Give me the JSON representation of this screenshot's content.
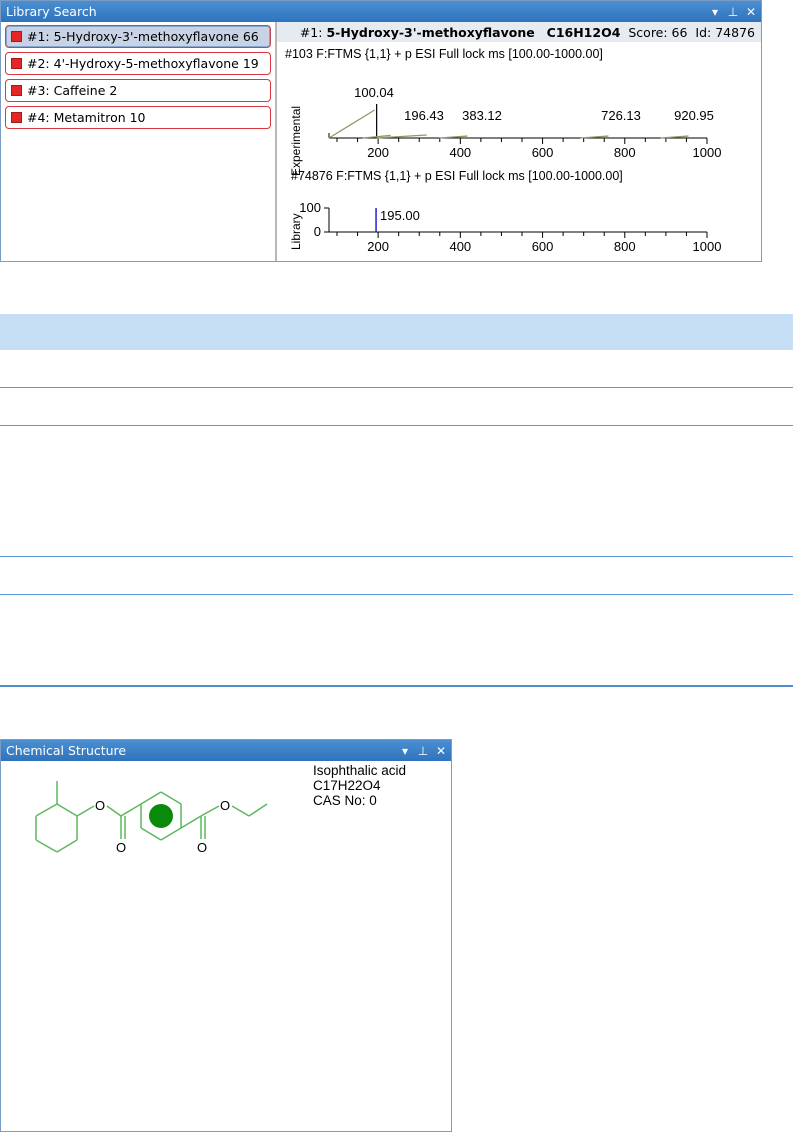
{
  "library_panel": {
    "title": "Library Search",
    "controls": {
      "dropdown": "▾",
      "pin": "⊥",
      "close": "✕"
    },
    "hits": [
      {
        "label": "#1: 5-Hydroxy-3'-methoxyflavone  66",
        "selected": true
      },
      {
        "label": "#2: 4'-Hydroxy-5-methoxyflavone  19",
        "selected": false
      },
      {
        "label": "#3: Caffeine  2",
        "selected": false
      },
      {
        "label": "#4: Metamitron  10",
        "selected": false
      }
    ],
    "header": {
      "rank": "#1:",
      "compound": "5-Hydroxy-3'-methoxyflavone",
      "formula": "C16H12O4",
      "score": "Score: 66",
      "id": "Id: 74876"
    }
  },
  "chart_data": [
    {
      "type": "bar",
      "title": "#103  F:FTMS {1,1}  + p ESI Full lock ms [100.00-1000.00]",
      "ylabel": "Experimental",
      "xlabel": "",
      "xlim": [
        100,
        1000
      ],
      "x_ticks": [
        200,
        400,
        600,
        800,
        1000
      ],
      "peak_labels": [
        "100.04",
        "196.43",
        "383.12",
        "726.13",
        "920.95"
      ],
      "peaks": [
        {
          "mz": 100.04,
          "intensity": 100
        },
        {
          "mz": 196.43,
          "intensity": 8
        },
        {
          "mz": 383.12,
          "intensity": 6
        },
        {
          "mz": 726.13,
          "intensity": 6
        },
        {
          "mz": 920.95,
          "intensity": 6
        }
      ],
      "color": "#8c9a66"
    },
    {
      "type": "bar",
      "title": "#74876   F:FTMS {1,1}  + p ESI Full lock ms [100.00-1000.00]",
      "ylabel": "Library",
      "xlabel": "",
      "xlim": [
        100,
        1000
      ],
      "ylim": [
        0,
        100
      ],
      "x_ticks": [
        200,
        400,
        600,
        800,
        1000
      ],
      "y_ticks": [
        0,
        100
      ],
      "peak_labels": [
        "195.00"
      ],
      "peaks": [
        {
          "mz": 195.0,
          "intensity": 100
        }
      ],
      "color": "#2222cc"
    }
  ],
  "chem_panel": {
    "title": "Chemical Structure",
    "controls": {
      "dropdown": "▾",
      "pin": "⊥",
      "close": "✕"
    },
    "name": "Isophthalic acid",
    "formula": "C17H22O4",
    "cas": "CAS No: 0",
    "bond_color": "#5cb85c",
    "ring_fill": "#0a8a0a",
    "atom_label": "O"
  }
}
